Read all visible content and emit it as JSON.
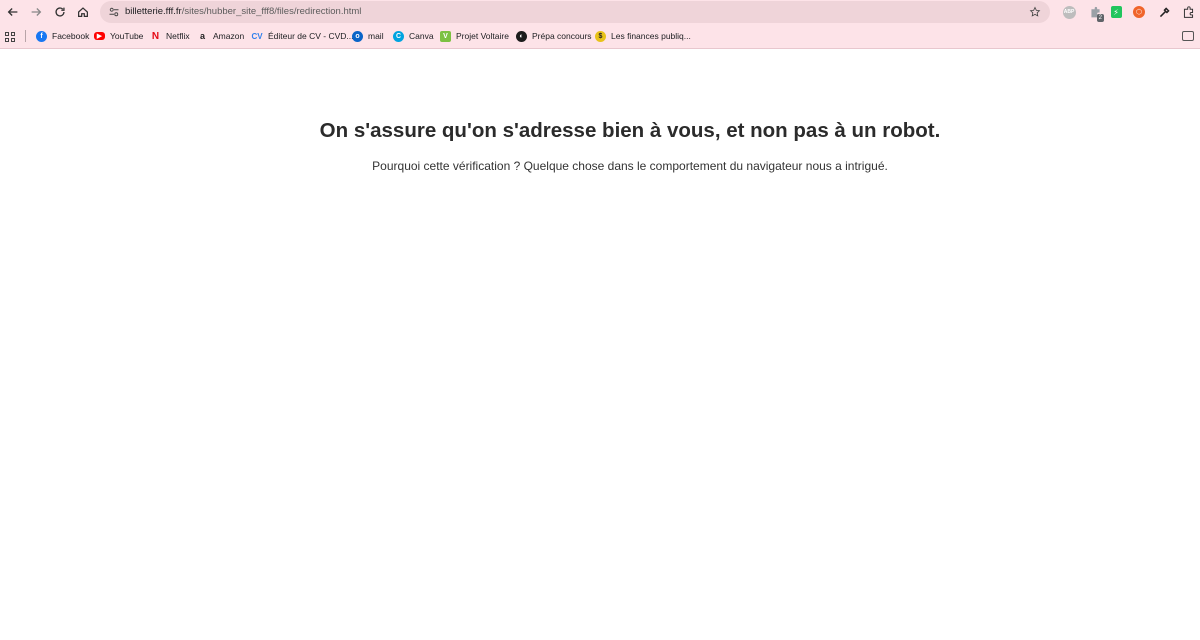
{
  "browser": {
    "url_host": "billetterie.fff.fr",
    "url_path": "/sites/hubber_site_fff8/files/redirection.html",
    "extensions": {
      "abp_label": "ABP",
      "badge_count": "2"
    },
    "bookmarks": [
      {
        "label": "Facebook",
        "icon": "facebook-icon",
        "color": "#1877f2"
      },
      {
        "label": "YouTube",
        "icon": "youtube-icon",
        "color": "#ff0000"
      },
      {
        "label": "Netflix",
        "icon": "netflix-icon",
        "color": "#e50914"
      },
      {
        "label": "Amazon",
        "icon": "amazon-icon",
        "color": "#222222"
      },
      {
        "label": "Éditeur de CV - CVD...",
        "icon": "cv-editor-icon",
        "color": "#2f80ed"
      },
      {
        "label": "mail",
        "icon": "outlook-icon",
        "color": "#0a64c8"
      },
      {
        "label": "Canva",
        "icon": "canva-icon",
        "color": "#00a3e0"
      },
      {
        "label": "Projet Voltaire",
        "icon": "voltaire-icon",
        "color": "#7cc142"
      },
      {
        "label": "Prépa concours",
        "icon": "prepa-icon",
        "color": "#1c1c1c"
      },
      {
        "label": "Les finances publiq...",
        "icon": "finances-icon",
        "color": "#e8c21a"
      }
    ]
  },
  "page": {
    "heading": "On s'assure qu'on s'adresse bien à vous, et non pas à un robot.",
    "subtext": "Pourquoi cette vérification ? Quelque chose dans le comportement du navigateur nous a intrigué."
  },
  "colors": {
    "chrome_bg": "#fde3e8",
    "omnibox_bg": "#efd4d9",
    "heading_text": "#2b2b2b"
  }
}
